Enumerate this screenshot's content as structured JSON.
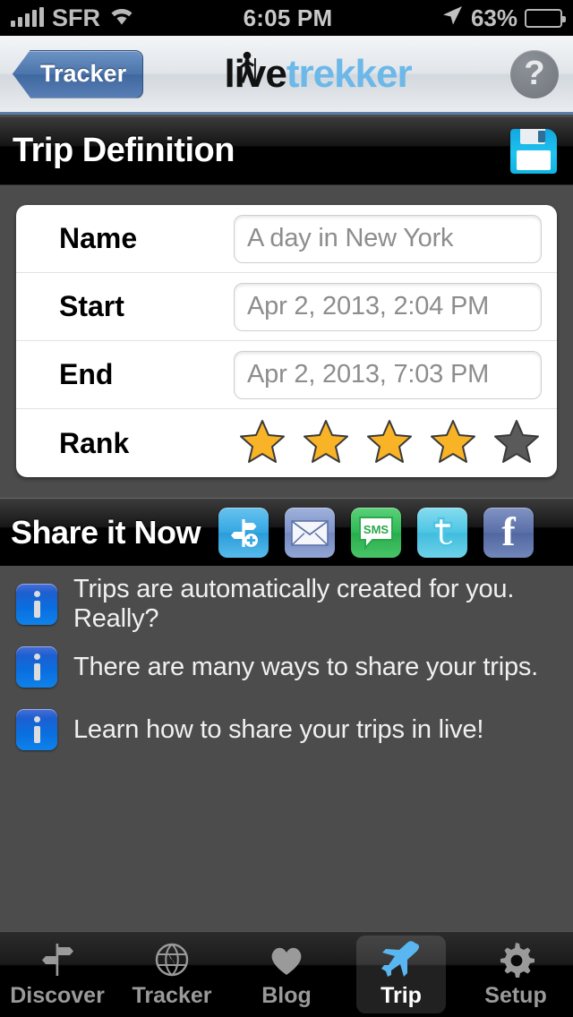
{
  "statusbar": {
    "carrier": "SFR",
    "time": "6:05 PM",
    "battery": "63%",
    "signal_icon": "signal-bars-icon",
    "wifi_icon": "wifi-icon",
    "location_icon": "location-arrow-icon",
    "battery_icon": "battery-icon",
    "battery_percent": 63
  },
  "navbar": {
    "back_label": "Tracker",
    "logo_primary": "live",
    "logo_secondary": "trekker",
    "help_label": "?",
    "accent_blue": "#6cb8e8",
    "back_button_blue": "#4a74ab"
  },
  "section": {
    "title": "Trip Definition",
    "save_icon": "floppy-disk-save-icon"
  },
  "form": {
    "rows": [
      {
        "label": "Name",
        "value": "A day in New York"
      },
      {
        "label": "Start",
        "value": "Apr 2, 2013, 2:04 PM"
      },
      {
        "label": "End",
        "value": "Apr 2, 2013, 7:03 PM"
      }
    ],
    "rank": {
      "label": "Rank",
      "value": 4,
      "max": 5,
      "filled_color": "#f8b326",
      "empty_color": "#5a5a5a"
    }
  },
  "share": {
    "title": "Share it Now",
    "icons": [
      {
        "name": "waypoint-add-icon",
        "label": "Add waypoint"
      },
      {
        "name": "email-icon",
        "label": "Email"
      },
      {
        "name": "sms-icon",
        "label": "SMS"
      },
      {
        "name": "twitter-icon",
        "label": "Twitter"
      },
      {
        "name": "facebook-icon",
        "label": "Facebook"
      }
    ],
    "sms_text": "SMS",
    "facebook_text": "f",
    "twitter_text": "t"
  },
  "info_items": [
    {
      "text": "Trips are automatically created for you. Really?",
      "icon": "info-icon"
    },
    {
      "text": "There are many ways to share your trips.",
      "icon": "info-icon"
    },
    {
      "text": "Learn how to share your trips in live!",
      "icon": "info-icon"
    }
  ],
  "tabbar": {
    "tabs": [
      {
        "label": "Discover",
        "icon": "signpost-icon",
        "active": false
      },
      {
        "label": "Tracker",
        "icon": "globe-icon",
        "active": false
      },
      {
        "label": "Blog",
        "icon": "heart-icon",
        "active": false
      },
      {
        "label": "Trip",
        "icon": "airplane-icon",
        "active": true
      },
      {
        "label": "Setup",
        "icon": "gear-icon",
        "active": false
      }
    ]
  }
}
